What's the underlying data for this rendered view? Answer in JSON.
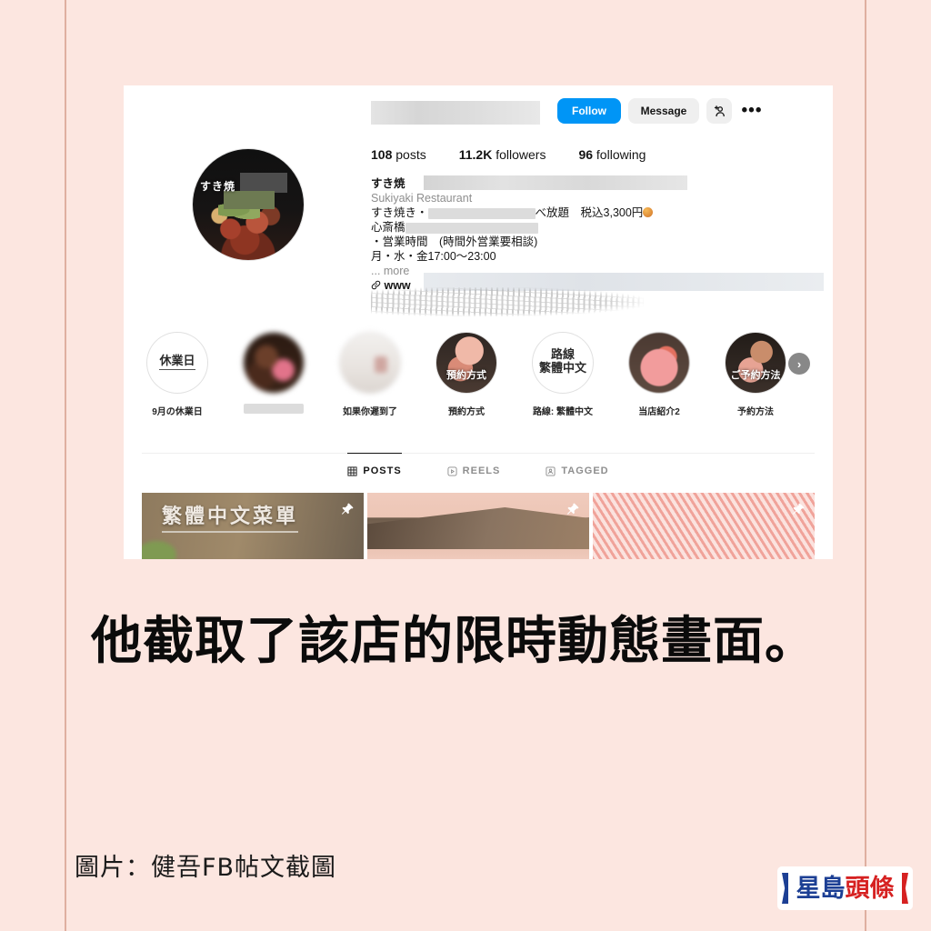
{
  "page": {
    "background_color": "#fce6e0",
    "guide_line_color": "#d9a494"
  },
  "instagram_card": {
    "profile": {
      "username_redacted": true,
      "actions": {
        "follow_label": "Follow",
        "message_label": "Message",
        "add_user_icon": "add-person-icon",
        "more_icon": "ellipsis-icon"
      },
      "stats": [
        {
          "value": "108",
          "label": "posts"
        },
        {
          "value": "11.2K",
          "label": "followers"
        },
        {
          "value": "96",
          "label": "following"
        }
      ],
      "bio": {
        "display_name": "すき焼",
        "category": "Sukiyaki Restaurant",
        "line_1_prefix": "すき焼き・",
        "line_1_suffix": "べ放題　税込3,300円",
        "line_2_prefix": "心斎橋",
        "line_3": "・営業時間　(時間外営業要相談)",
        "line_4": "月・水・金17:00〜23:00",
        "more_label": "... more",
        "website_prefix": "www"
      }
    },
    "highlights": [
      {
        "name": "highlight-kyugyobi",
        "cover_text": "休業日",
        "label": "9月の休業日",
        "cover_type": "text"
      },
      {
        "name": "highlight-blurred",
        "cover_text": "",
        "label": "",
        "cover_type": "photo",
        "label_blurred": true
      },
      {
        "name": "highlight-late",
        "cover_text": "",
        "label": "如果你遲到了",
        "cover_type": "photo"
      },
      {
        "name": "highlight-reservation-cn",
        "cover_text": "預約方式",
        "label": "預約方式",
        "cover_type": "photo"
      },
      {
        "name": "highlight-route-cn",
        "cover_text": "路線\n繁體中文",
        "label": "路線: 繁體中文",
        "cover_type": "text"
      },
      {
        "name": "highlight-shop-intro-2",
        "cover_text": "",
        "label": "当店紹介2",
        "cover_type": "photo"
      },
      {
        "name": "highlight-reservation-jp",
        "cover_text": "ご予約方法",
        "label": "予約方法",
        "cover_type": "photo"
      }
    ],
    "next_arrow_icon": "chevron-right-icon",
    "tabs": [
      {
        "label": "POSTS",
        "icon": "grid-icon",
        "active": true
      },
      {
        "label": "REELS",
        "icon": "reels-icon",
        "active": false
      },
      {
        "label": "TAGGED",
        "icon": "tagged-person-icon",
        "active": false
      }
    ],
    "grid_posts": [
      {
        "name": "post-menu-traditional-chinese",
        "overlay_text": "繁體中文菜單",
        "pinned": true
      },
      {
        "name": "post-table-photo",
        "overlay_text": "",
        "pinned": true
      },
      {
        "name": "post-marbled-beef",
        "overlay_text": "",
        "pinned": true
      }
    ]
  },
  "caption": {
    "text": "他截取了該店的限時動態畫面。"
  },
  "credit": {
    "text": "圖片：健吾FB帖文截圖"
  },
  "logo": {
    "text_blue": "星島",
    "text_red": "頭條",
    "blue": "#1c3f94",
    "red": "#d62121"
  }
}
